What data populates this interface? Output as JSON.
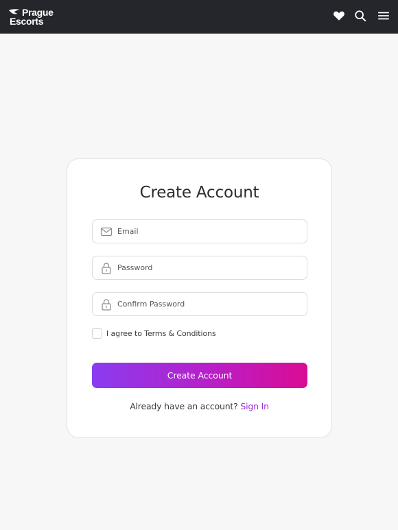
{
  "header": {
    "logo": {
      "line1": "Prague",
      "line2": "Escorts"
    },
    "icons": [
      "heart-icon",
      "search-icon",
      "menu-icon"
    ],
    "background": "#25262b"
  },
  "form": {
    "title": "Create Account",
    "email": {
      "placeholder": "Email",
      "value": ""
    },
    "password": {
      "placeholder": "Password",
      "value": ""
    },
    "confirm_password": {
      "placeholder": "Confirm Password",
      "value": ""
    },
    "agree": {
      "prefix": "I agree to ",
      "link": "Terms & Conditions",
      "checked": false
    },
    "submit_label": "Create Account",
    "signin_prompt": "Already have an account? ",
    "signin_link": "Sign In"
  },
  "colors": {
    "accent_start": "#8a3cf0",
    "accent_end": "#da0c94",
    "link": "#9a2fd8"
  }
}
